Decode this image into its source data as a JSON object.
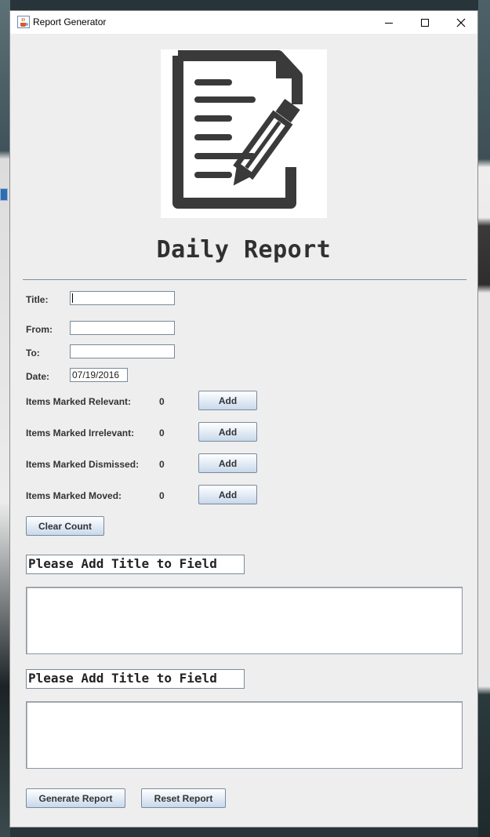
{
  "window": {
    "title": "Report Generator",
    "icons": {
      "app": "java-cup-icon",
      "minimize": "minimize-icon",
      "maximize": "maximize-icon",
      "close": "close-icon"
    }
  },
  "header": {
    "logo_icon": "report-document-pencil-icon",
    "title": "Daily Report"
  },
  "form": {
    "title_label": "Title:",
    "title_value": "",
    "from_label": "From:",
    "from_value": "",
    "to_label": "To:",
    "to_value": "",
    "date_label": "Date:",
    "date_value": "07/19/2016"
  },
  "counters": [
    {
      "label": "Items Marked Relevant:",
      "count": "0",
      "button": "Add"
    },
    {
      "label": "Items Marked Irrelevant:",
      "count": "0",
      "button": "Add"
    },
    {
      "label": "Items Marked Dismissed:",
      "count": "0",
      "button": "Add"
    },
    {
      "label": "Items Marked Moved:",
      "count": "0",
      "button": "Add"
    }
  ],
  "clear_button": "Clear Count",
  "sections": [
    {
      "title": "Please Add Title to Field",
      "body": ""
    },
    {
      "title": "Please Add Title to Field",
      "body": ""
    }
  ],
  "footer": {
    "generate_button": "Generate Report",
    "reset_button": "Reset Report"
  },
  "colors": {
    "window_bg": "#eeeeee",
    "button_gradient_end": "#c8d8ea",
    "logo_dark": "#3a3a3a"
  }
}
